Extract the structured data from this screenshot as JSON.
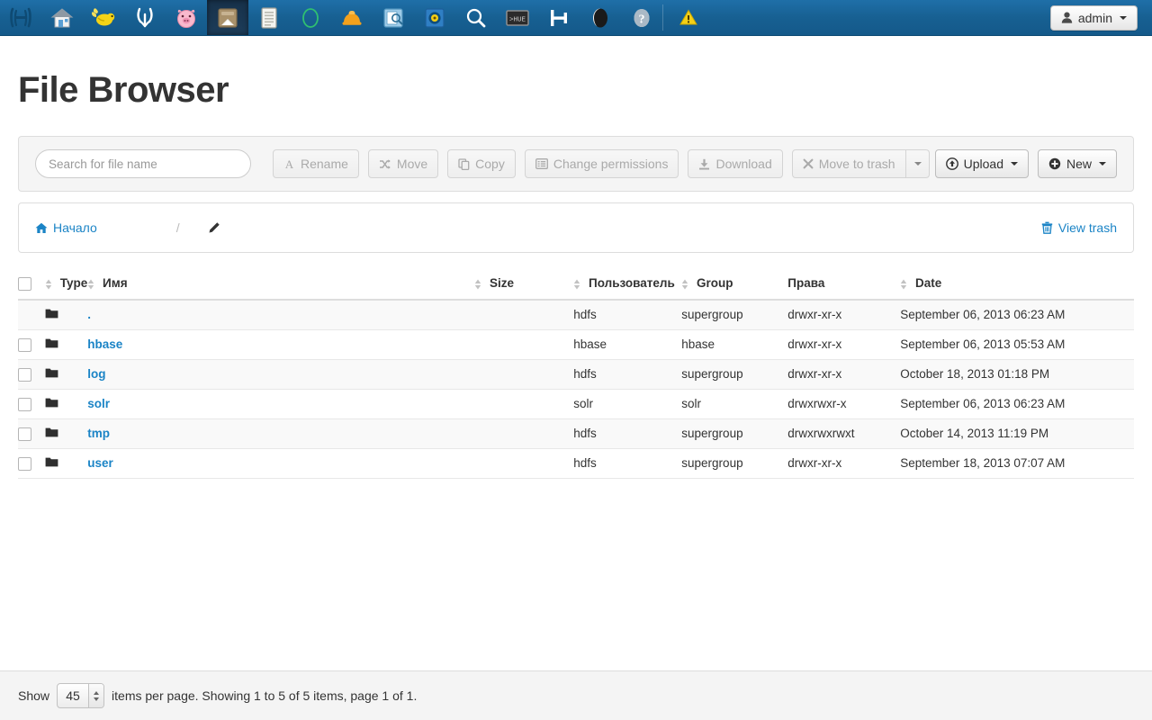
{
  "navbar": {
    "apps": [
      {
        "name": "hue-logo-icon",
        "title": "Hue",
        "active": false
      },
      {
        "name": "home-icon",
        "title": "Home",
        "active": false
      },
      {
        "name": "beeswax-bee-icon",
        "title": "Beeswax",
        "active": false
      },
      {
        "name": "impala-icon",
        "title": "Impala",
        "active": false
      },
      {
        "name": "pig-icon",
        "title": "Pig",
        "active": false
      },
      {
        "name": "file-browser-icon",
        "title": "File Browser",
        "active": true
      },
      {
        "name": "job-designer-icon",
        "title": "Job Designer",
        "active": false
      },
      {
        "name": "oozie-circle-icon",
        "title": "Oozie",
        "active": false
      },
      {
        "name": "hard-hat-icon",
        "title": "Job Browser",
        "active": false
      },
      {
        "name": "metastore-icon",
        "title": "Metastore Manager",
        "active": false
      },
      {
        "name": "sqoop-icon",
        "title": "Sqoop",
        "active": false
      },
      {
        "name": "search-magnifier-icon",
        "title": "Search",
        "active": false
      },
      {
        "name": "hue-shell-icon",
        "title": "Shell",
        "active": false
      },
      {
        "name": "hbase-icon",
        "title": "HBase",
        "active": false
      },
      {
        "name": "zookeeper-icon",
        "title": "ZooKeeper",
        "active": false
      },
      {
        "name": "help-question-icon",
        "title": "Help",
        "active": false
      }
    ],
    "warning_icon": "warning-triangle-icon",
    "user": {
      "label": "admin",
      "icon": "user-silhouette-icon"
    }
  },
  "page": {
    "title": "File Browser"
  },
  "toolbar": {
    "search_placeholder": "Search for file name",
    "search_value": "",
    "buttons": [
      {
        "label": "Rename",
        "icon": "letter-a-icon",
        "enabled": false
      },
      {
        "label": "Move",
        "icon": "shuffle-arrows-icon",
        "enabled": false
      },
      {
        "label": "Copy",
        "icon": "copy-pages-icon",
        "enabled": false
      },
      {
        "label": "Change permissions",
        "icon": "list-alt-icon",
        "enabled": false
      },
      {
        "label": "Download",
        "icon": "download-icon",
        "enabled": false
      },
      {
        "label": "Move to trash",
        "icon": "x-mark-icon",
        "enabled": false
      }
    ],
    "trash_caret_label": "",
    "upload": {
      "label": "Upload",
      "icon": "upload-circle-icon"
    },
    "new": {
      "label": "New",
      "icon": "plus-circle-icon"
    }
  },
  "breadcrumb": {
    "home_label": "Начало",
    "home_icon": "home-icon",
    "separator": "/",
    "edit_icon": "pencil-icon",
    "view_trash_label": "View trash",
    "view_trash_icon": "trash-icon"
  },
  "table": {
    "headers": {
      "type": "Type",
      "name": "Имя",
      "size": "Size",
      "user": "Пользователь",
      "group": "Group",
      "permissions": "Права",
      "date": "Date"
    },
    "rows": [
      {
        "checkbox": false,
        "type_icon": "folder-icon",
        "name": ".",
        "size": "",
        "user": "hdfs",
        "group": "supergroup",
        "permissions": "drwxr-xr-x",
        "date": "September 06, 2013 06:23 AM"
      },
      {
        "checkbox": true,
        "type_icon": "folder-icon",
        "name": "hbase",
        "size": "",
        "user": "hbase",
        "group": "hbase",
        "permissions": "drwxr-xr-x",
        "date": "September 06, 2013 05:53 AM"
      },
      {
        "checkbox": true,
        "type_icon": "folder-icon",
        "name": "log",
        "size": "",
        "user": "hdfs",
        "group": "supergroup",
        "permissions": "drwxr-xr-x",
        "date": "October 18, 2013 01:18 PM"
      },
      {
        "checkbox": true,
        "type_icon": "folder-icon",
        "name": "solr",
        "size": "",
        "user": "solr",
        "group": "solr",
        "permissions": "drwxrwxr-x",
        "date": "September 06, 2013 06:23 AM"
      },
      {
        "checkbox": true,
        "type_icon": "folder-icon",
        "name": "tmp",
        "size": "",
        "user": "hdfs",
        "group": "supergroup",
        "permissions": "drwxrwxrwxt",
        "date": "October 14, 2013 11:19 PM"
      },
      {
        "checkbox": true,
        "type_icon": "folder-icon",
        "name": "user",
        "size": "",
        "user": "hdfs",
        "group": "supergroup",
        "permissions": "drwxr-xr-x",
        "date": "September 18, 2013 07:07 AM"
      }
    ]
  },
  "footer": {
    "show_label": "Show",
    "page_size": "45",
    "status_text": "items per page. Showing 1 to 5 of 5 items, page 1 of 1."
  },
  "colors": {
    "navbar_top": "#1f6fa8",
    "navbar_bottom": "#14598a",
    "link": "#1b84c6",
    "panel_bg": "#f5f5f5",
    "border": "#dddddd",
    "warning": "#f5d016"
  }
}
